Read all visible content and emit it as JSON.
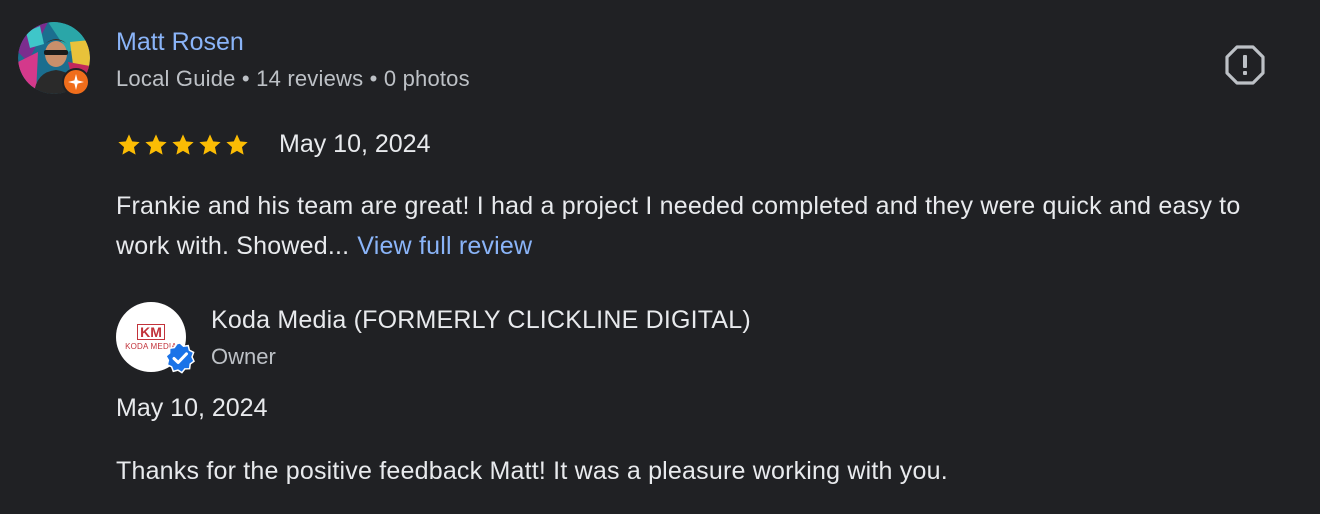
{
  "review": {
    "reviewer": {
      "name": "Matt Rosen",
      "meta": "Local Guide • 14 reviews • 0 photos",
      "badge_icon": "local-guide-star-icon",
      "badge_color": "#f06d1b"
    },
    "report_icon": "report-flag-icon",
    "rating": 5,
    "rating_max": 5,
    "star_color": "#fbbc04",
    "date": "May 10, 2024",
    "text": "Frankie and his team are great! I had a project I needed completed and they were quick and easy to work with. Showed...",
    "view_full_label": "View full review"
  },
  "owner_response": {
    "name": "Koda Media (FORMERLY CLICKLINE DIGITAL)",
    "role": "Owner",
    "logo_mark": "KM",
    "logo_text": "KODA MEDIA",
    "verified_icon": "verified-check-icon",
    "verified_color": "#1a73e8",
    "date": "May 10, 2024",
    "text": "Thanks for the positive feedback Matt! It was a pleasure working with you."
  },
  "colors": {
    "background": "#202124",
    "link": "#8ab4f8",
    "text_primary": "#e8eaed",
    "text_secondary": "#bdc1c6"
  }
}
